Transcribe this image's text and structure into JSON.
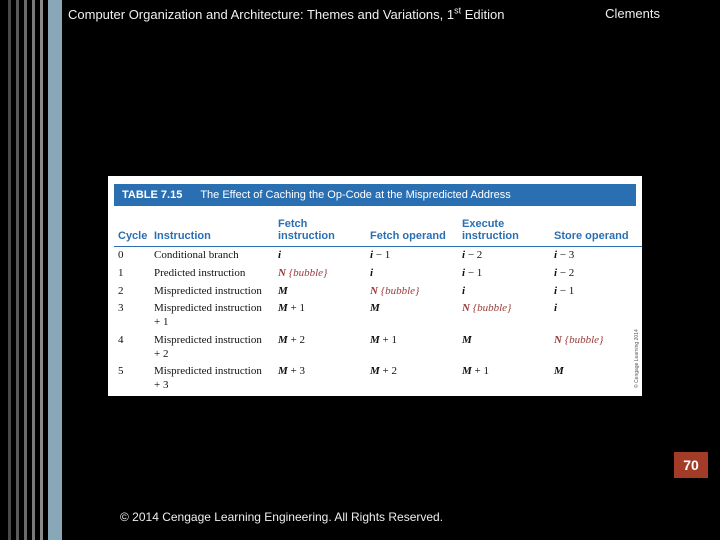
{
  "header": {
    "book_title_main": "Computer Organization and Architecture: Themes and Variations, 1",
    "book_title_sup": "st",
    "book_title_after": " Edition",
    "author": "Clements"
  },
  "table": {
    "label": "TABLE 7.15",
    "caption": "The Effect of Caching the Op-Code at the Mispredicted Address",
    "columns": {
      "cycle": "Cycle",
      "instruction": "Instruction",
      "fetch_instruction": "Fetch instruction",
      "fetch_operand": "Fetch operand",
      "execute_instruction": "Execute instruction",
      "store_operand": "Store operand"
    },
    "rows": [
      {
        "cycle": "0",
        "instruction": "Conditional branch",
        "fi": "i",
        "fo": "i − 1",
        "ei": "i − 2",
        "so": "i − 3"
      },
      {
        "cycle": "1",
        "instruction": "Predicted instruction",
        "fi": "N {bubble}",
        "fo": "i",
        "ei": "i − 1",
        "so": "i − 2"
      },
      {
        "cycle": "2",
        "instruction": "Mispredicted instruction",
        "fi": "M",
        "fo": "N {bubble}",
        "ei": "i",
        "so": "i − 1"
      },
      {
        "cycle": "3",
        "instruction": "Mispredicted instruction + 1",
        "fi": "M + 1",
        "fo": "M",
        "ei": "N {bubble}",
        "so": "i"
      },
      {
        "cycle": "4",
        "instruction": "Mispredicted instruction + 2",
        "fi": "M + 2",
        "fo": "M + 1",
        "ei": "M",
        "so": "N {bubble}"
      },
      {
        "cycle": "5",
        "instruction": "Mispredicted instruction + 3",
        "fi": "M + 3",
        "fo": "M + 2",
        "ei": "M + 1",
        "so": "M"
      }
    ],
    "side_copyright": "© Cengage Learning 2014"
  },
  "page_number": "70",
  "footer": "© 2014 Cengage Learning Engineering. All Rights Reserved."
}
